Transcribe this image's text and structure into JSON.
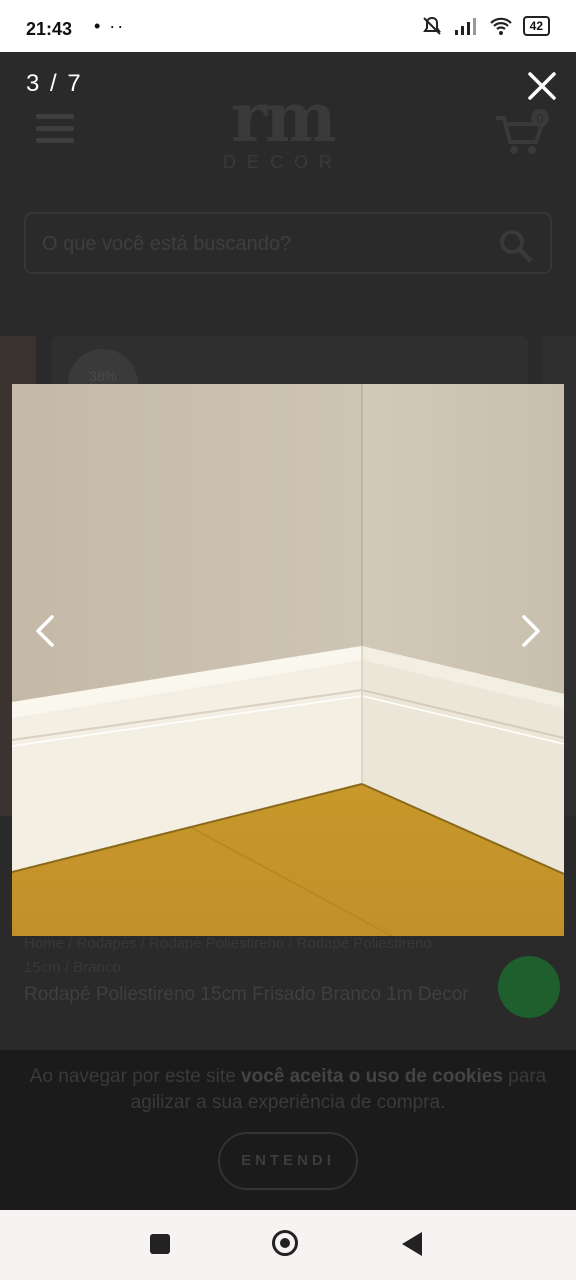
{
  "status_bar": {
    "time": "21:43",
    "dots": "• ··",
    "battery": "42"
  },
  "background_site": {
    "logo_main": "rm",
    "logo_sub": "DECOR",
    "cart_count": "0",
    "search_placeholder": "O que você está buscando?",
    "discount_badge": "38%",
    "breadcrumb_text": "Home / Rodapés / Rodapé Poliestireno / Rodapé Poliestireno 15cm / Branco",
    "product_title": "Rodapé Poliestireno 15cm Frisado Branco 1m Decor",
    "cookie_text_plain_1": "Ao navegar por este site ",
    "cookie_text_bold_1": "você aceita o uso de cookies",
    "cookie_text_plain_2": " para agilizar a sua experiência de compra.",
    "cookie_button": "ENTENDI"
  },
  "viewer": {
    "counter": "3 / 7",
    "icons": {
      "close": "close-icon",
      "prev": "chevron-left-icon",
      "next": "chevron-right-icon"
    }
  },
  "colors": {
    "wall": "#c9bfae",
    "baseboard": "#f4f0e4",
    "floor": "#c99a2a",
    "overlay": "#1e1e1e"
  }
}
